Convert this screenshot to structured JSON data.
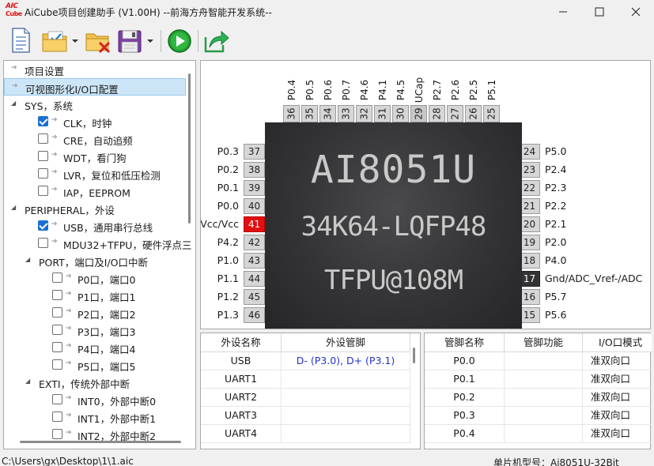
{
  "app": {
    "logo_top": "AIC",
    "logo_bottom": "Cube",
    "title": "AiCube项目创建助手 (V1.00H) --前海方舟智能开发系统--"
  },
  "toolbar": {
    "buttons": [
      "new-document-icon",
      "open-project-icon",
      "delete-project-icon",
      "save-icon",
      "run-icon",
      "export-icon"
    ]
  },
  "tree": {
    "items": [
      {
        "label": "项目设置",
        "kind": "leaf",
        "level": 0,
        "checked": null
      },
      {
        "label": "可视图形化I/O口配置",
        "kind": "leaf",
        "level": 0,
        "checked": null,
        "selected": true
      },
      {
        "label": "SYS，系统",
        "kind": "group",
        "level": 0,
        "checked": null
      },
      {
        "label": "CLK，时钟",
        "kind": "leaf",
        "level": 1,
        "checked": true
      },
      {
        "label": "CRE，自动追频",
        "kind": "leaf",
        "level": 1,
        "checked": false
      },
      {
        "label": "WDT，看门狗",
        "kind": "leaf",
        "level": 1,
        "checked": false
      },
      {
        "label": "LVR，复位和低压检测",
        "kind": "leaf",
        "level": 1,
        "checked": false
      },
      {
        "label": "IAP，EEPROM",
        "kind": "leaf",
        "level": 1,
        "checked": false
      },
      {
        "label": "PERIPHERAL，外设",
        "kind": "group",
        "level": 0,
        "checked": null
      },
      {
        "label": "USB，通用串行总线",
        "kind": "leaf",
        "level": 1,
        "checked": true
      },
      {
        "label": "MDU32+TFPU，硬件浮点三",
        "kind": "leaf",
        "level": 1,
        "checked": false
      },
      {
        "label": "PORT，端口及I/O口中断",
        "kind": "group",
        "level": 1,
        "checked": null
      },
      {
        "label": "P0口，端口0",
        "kind": "leaf",
        "level": 2,
        "checked": false
      },
      {
        "label": "P1口，端口1",
        "kind": "leaf",
        "level": 2,
        "checked": false
      },
      {
        "label": "P2口，端口2",
        "kind": "leaf",
        "level": 2,
        "checked": false
      },
      {
        "label": "P3口，端口3",
        "kind": "leaf",
        "level": 2,
        "checked": false
      },
      {
        "label": "P4口，端口4",
        "kind": "leaf",
        "level": 2,
        "checked": false
      },
      {
        "label": "P5口，端口5",
        "kind": "leaf",
        "level": 2,
        "checked": false
      },
      {
        "label": "EXTI，传统外部中断",
        "kind": "group",
        "level": 1,
        "checked": null
      },
      {
        "label": "INT0，外部中断0",
        "kind": "leaf",
        "level": 2,
        "checked": false
      },
      {
        "label": "INT1，外部中断1",
        "kind": "leaf",
        "level": 2,
        "checked": false
      },
      {
        "label": "INT2，外部中断2",
        "kind": "leaf",
        "level": 2,
        "checked": false
      }
    ]
  },
  "chip": {
    "lines": [
      "AI8051U",
      "34K64-LQFP48",
      "TFPU@108M"
    ],
    "top_pins": [
      {
        "num": "36",
        "name": "P0.4"
      },
      {
        "num": "35",
        "name": "P0.5"
      },
      {
        "num": "34",
        "name": "P0.6"
      },
      {
        "num": "33",
        "name": "P0.7"
      },
      {
        "num": "32",
        "name": "P4.6"
      },
      {
        "num": "31",
        "name": "P4.1"
      },
      {
        "num": "30",
        "name": "P4.5"
      },
      {
        "num": "29",
        "name": "UCap"
      },
      {
        "num": "28",
        "name": "P2.7"
      },
      {
        "num": "27",
        "name": "P2.6"
      },
      {
        "num": "26",
        "name": "P2.5"
      },
      {
        "num": "25",
        "name": "P5.1"
      }
    ],
    "left_pins": [
      {
        "num": "37",
        "name": "P0.3",
        "state": "normal"
      },
      {
        "num": "38",
        "name": "P0.2",
        "state": "normal"
      },
      {
        "num": "39",
        "name": "P0.1",
        "state": "normal"
      },
      {
        "num": "40",
        "name": "P0.0",
        "state": "normal"
      },
      {
        "num": "41",
        "name": "Vcc/Vcc",
        "state": "power"
      },
      {
        "num": "42",
        "name": "P4.2",
        "state": "normal"
      },
      {
        "num": "43",
        "name": "P1.0",
        "state": "normal"
      },
      {
        "num": "44",
        "name": "P1.1",
        "state": "normal"
      },
      {
        "num": "45",
        "name": "P1.2",
        "state": "normal"
      },
      {
        "num": "46",
        "name": "P1.3",
        "state": "normal"
      }
    ],
    "right_pins": [
      {
        "num": "24",
        "name": "P5.0",
        "state": "normal"
      },
      {
        "num": "23",
        "name": "P2.4",
        "state": "normal"
      },
      {
        "num": "22",
        "name": "P2.3",
        "state": "normal"
      },
      {
        "num": "21",
        "name": "P2.2",
        "state": "normal"
      },
      {
        "num": "20",
        "name": "P2.1",
        "state": "normal"
      },
      {
        "num": "19",
        "name": "P2.0",
        "state": "normal"
      },
      {
        "num": "18",
        "name": "P4.0",
        "state": "normal"
      },
      {
        "num": "17",
        "name": "Gnd/ADC_Vref-/ADC",
        "state": "ground"
      },
      {
        "num": "16",
        "name": "P5.7",
        "state": "normal"
      },
      {
        "num": "15",
        "name": "P5.6",
        "state": "normal"
      }
    ]
  },
  "peripheral_table": {
    "headers": [
      "外设名称",
      "外设管脚"
    ],
    "rows": [
      [
        "USB",
        "D- (P3.0), D+ (P3.1)"
      ],
      [
        "UART1",
        ""
      ],
      [
        "UART2",
        ""
      ],
      [
        "UART3",
        ""
      ],
      [
        "UART4",
        ""
      ]
    ]
  },
  "pin_table": {
    "headers": [
      "管脚名称",
      "管脚功能",
      "I/O口模式"
    ],
    "rows": [
      [
        "P0.0",
        "",
        "准双向口"
      ],
      [
        "P0.1",
        "",
        "准双向口"
      ],
      [
        "P0.2",
        "",
        "准双向口"
      ],
      [
        "P0.3",
        "",
        "准双向口"
      ],
      [
        "P0.4",
        "",
        "准双向口"
      ]
    ]
  },
  "status": {
    "path": "C:\\Users\\gx\\Desktop\\1\\1.aic",
    "mcu": "单片机型号：Ai8051U-32Bit"
  },
  "colors": {
    "power_pin": "#e01010",
    "ground_pin": "#333333",
    "selection": "#cde6f7",
    "link_blue": "#2233cc"
  }
}
